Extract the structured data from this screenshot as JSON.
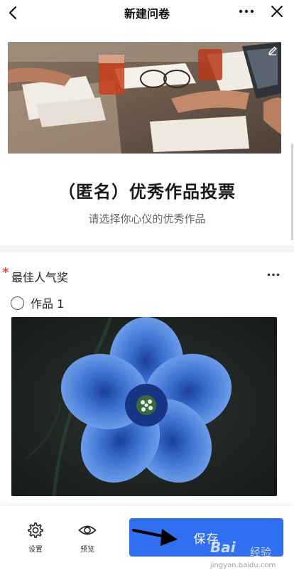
{
  "nav": {
    "title": "新建问卷",
    "back_icon": "chevron-left-icon",
    "more_icon": "more-horizontal-icon",
    "close_icon": "close-icon"
  },
  "cover": {
    "edit_icon": "pencil-icon"
  },
  "survey": {
    "title": "（匿名）优秀作品投票",
    "description": "请选择你心仪的优秀作品"
  },
  "question": {
    "required_mark": "*",
    "title": "最佳人气奖",
    "more_icon": "more-horizontal-icon",
    "options": [
      {
        "label": "作品 1",
        "selected": false
      }
    ]
  },
  "toolbar": {
    "settings_label": "设置",
    "preview_label": "预览",
    "save_label": "保存"
  },
  "watermark": {
    "brand": "Bai",
    "sub": "经验",
    "url": "jingyan.baidu.com"
  },
  "colors": {
    "accent": "#2f6ff0",
    "required": "#e84a3a"
  }
}
